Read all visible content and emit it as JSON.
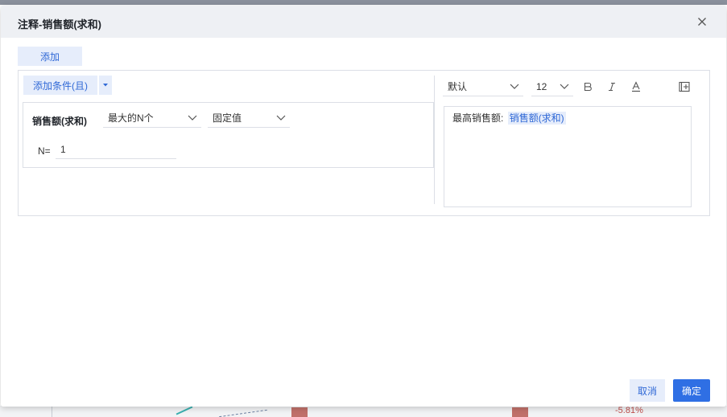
{
  "dialog": {
    "title": "注释-销售额(求和)",
    "close_icon": "close-icon"
  },
  "add_button_label": "添加",
  "condition": {
    "add_condition_label": "添加条件(且)",
    "dropdown_icon": "caret-down-icon",
    "field_label": "销售额(求和)",
    "rank_select_value": "最大的N个",
    "mode_select_value": "固定值",
    "n_label": "N=",
    "n_value": "1"
  },
  "format_toolbar": {
    "font_value": "默认",
    "size_value": "12",
    "bold_icon": "bold-icon",
    "italic_icon": "italic-icon",
    "color_icon": "font-color-icon",
    "layout_icon": "insert-field-icon"
  },
  "editor": {
    "text": "最高销售额:",
    "field_tag": "销售额(求和)"
  },
  "footer": {
    "cancel_label": "取消",
    "ok_label": "确定"
  },
  "background": {
    "percent_label": "-5.81%"
  },
  "colors": {
    "accent": "#2f6fe4",
    "accent_light": "#e6edfb",
    "header_bg": "#eef0f4"
  }
}
